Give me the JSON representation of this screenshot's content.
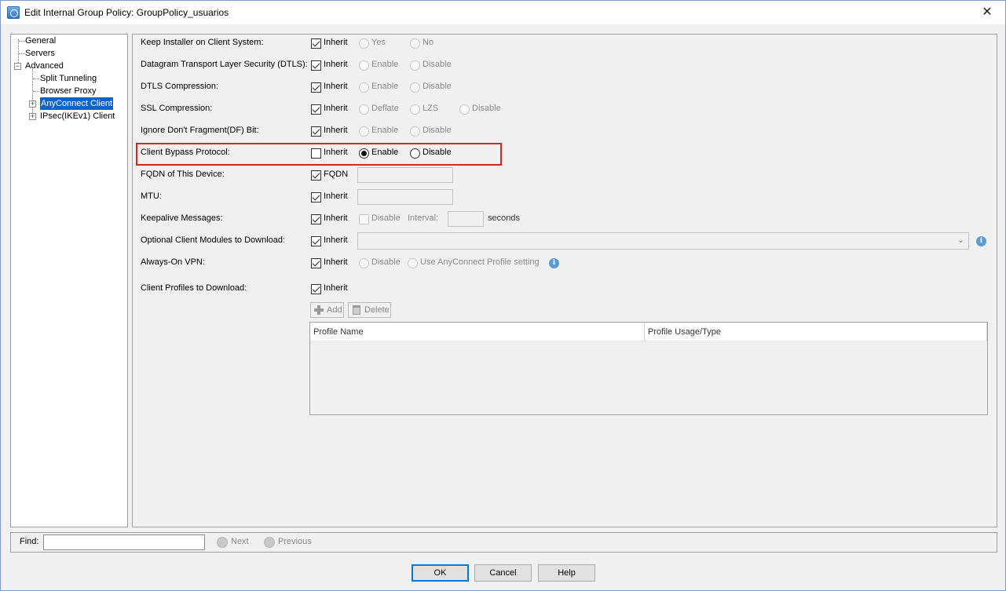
{
  "window": {
    "title": "Edit Internal Group Policy: GroupPolicy_usuarios",
    "close_glyph": "✕"
  },
  "nav": {
    "items": [
      {
        "label": "General"
      },
      {
        "label": "Servers"
      },
      {
        "label": "Advanced"
      },
      {
        "label": "Split Tunneling"
      },
      {
        "label": "Browser Proxy"
      },
      {
        "label": "AnyConnect Client"
      },
      {
        "label": "IPsec(IKEv1) Client"
      }
    ],
    "selected": "AnyConnect Client"
  },
  "form": {
    "keep_installer": {
      "label": "Keep Installer on Client System:",
      "inherit": "Inherit",
      "inherit_checked": true,
      "opt1": "Yes",
      "opt2": "No"
    },
    "dtls": {
      "label": "Datagram Transport Layer Security (DTLS):",
      "inherit": "Inherit",
      "inherit_checked": true,
      "opt1": "Enable",
      "opt2": "Disable"
    },
    "dtls_compression": {
      "label": "DTLS Compression:",
      "inherit": "Inherit",
      "inherit_checked": true,
      "opt1": "Enable",
      "opt2": "Disable"
    },
    "ssl_compression": {
      "label": "SSL Compression:",
      "inherit": "Inherit",
      "inherit_checked": true,
      "opt1": "Deflate",
      "opt2": "LZS",
      "opt3": "Disable"
    },
    "ignore_df": {
      "label": "Ignore Don't Fragment(DF) Bit:",
      "inherit": "Inherit",
      "inherit_checked": true,
      "opt1": "Enable",
      "opt2": "Disable"
    },
    "client_bypass": {
      "label": "Client Bypass Protocol:",
      "inherit": "Inherit",
      "inherit_checked": false,
      "opt1": "Enable",
      "opt2": "Disable",
      "selected": "Enable"
    },
    "fqdn": {
      "label": "FQDN of This Device:",
      "check_label": "FQDN",
      "checked": true,
      "value": ""
    },
    "mtu": {
      "label": "MTU:",
      "inherit": "Inherit",
      "inherit_checked": true,
      "value": ""
    },
    "keepalive": {
      "label": "Keepalive Messages:",
      "inherit": "Inherit",
      "inherit_checked": true,
      "disable": "Disable",
      "interval_label": "Interval:",
      "interval_value": "",
      "unit": "seconds"
    },
    "optional_modules": {
      "label": "Optional Client Modules to Download:",
      "inherit": "Inherit",
      "inherit_checked": true,
      "selected": "",
      "chevron": "⌄"
    },
    "always_on": {
      "label": "Always-On VPN:",
      "inherit": "Inherit",
      "inherit_checked": true,
      "opt1": "Disable",
      "opt2": "Use AnyConnect Profile setting"
    },
    "client_profiles": {
      "label": "Client Profiles to Download:",
      "inherit": "Inherit",
      "inherit_checked": true,
      "add": "Add",
      "delete": "Delete"
    },
    "info_glyph": "i"
  },
  "profiles_table": {
    "columns": [
      "Profile Name",
      "Profile Usage/Type"
    ],
    "rows": []
  },
  "find": {
    "label": "Find:",
    "value": "",
    "next": "Next",
    "previous": "Previous"
  },
  "buttons": {
    "ok": "OK",
    "cancel": "Cancel",
    "help": "Help"
  },
  "colors": {
    "selection": "#0a64d0",
    "highlight_box": "#d8232a",
    "info": "#5b9bd5"
  }
}
